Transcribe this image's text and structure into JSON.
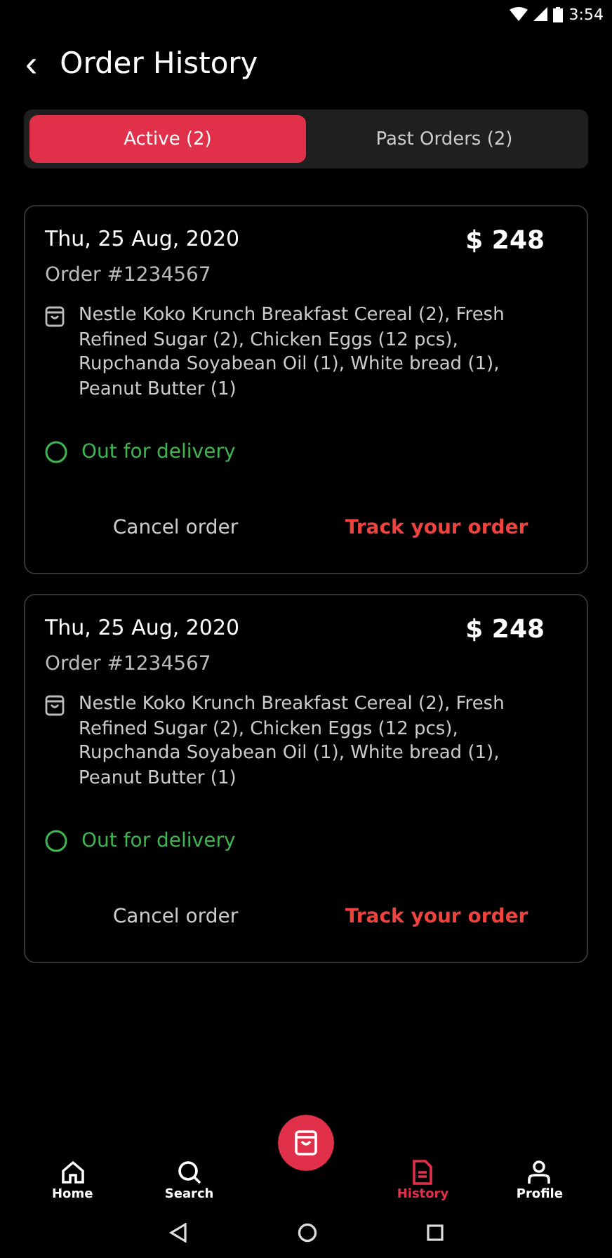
{
  "status_bar": {
    "time": "3:54"
  },
  "header": {
    "back": "‹",
    "title": "Order History"
  },
  "tabs": [
    {
      "label": "Active (2)",
      "selected": true
    },
    {
      "label": "Past Orders (2)",
      "selected": false
    }
  ],
  "orders": [
    {
      "date": "Thu, 25 Aug, 2020",
      "total": "$ 248",
      "number": "Order #1234567",
      "items": "Nestle Koko Krunch Breakfast Cereal (2), Fresh Refined Sugar (2), Chicken Eggs (12 pcs), Rupchanda Soyabean Oil (1), White bread (1), Peanut Butter (1)",
      "status": "Out for delivery",
      "actions": [
        "Cancel order",
        "Track your order"
      ]
    },
    {
      "date": "Thu, 25 Aug, 2020",
      "total": "$ 248",
      "number": "Order #1234567",
      "items": "Nestle Koko Krunch Breakfast Cereal (2), Fresh Refined Sugar (2), Chicken Eggs (12 pcs), Rupchanda Soyabean Oil (1), White bread (1), Peanut Butter (1)",
      "status": "Out for delivery",
      "actions": [
        "Cancel order",
        "Track your order"
      ]
    }
  ],
  "bottom_nav": [
    {
      "kind": "home",
      "label": "Home",
      "selected": false
    },
    {
      "kind": "search",
      "label": "Search",
      "selected": false
    },
    {
      "kind": "cart",
      "selected": false
    },
    {
      "kind": "history",
      "label": "History",
      "selected": true
    },
    {
      "kind": "profile",
      "label": "Profile",
      "selected": false
    }
  ]
}
